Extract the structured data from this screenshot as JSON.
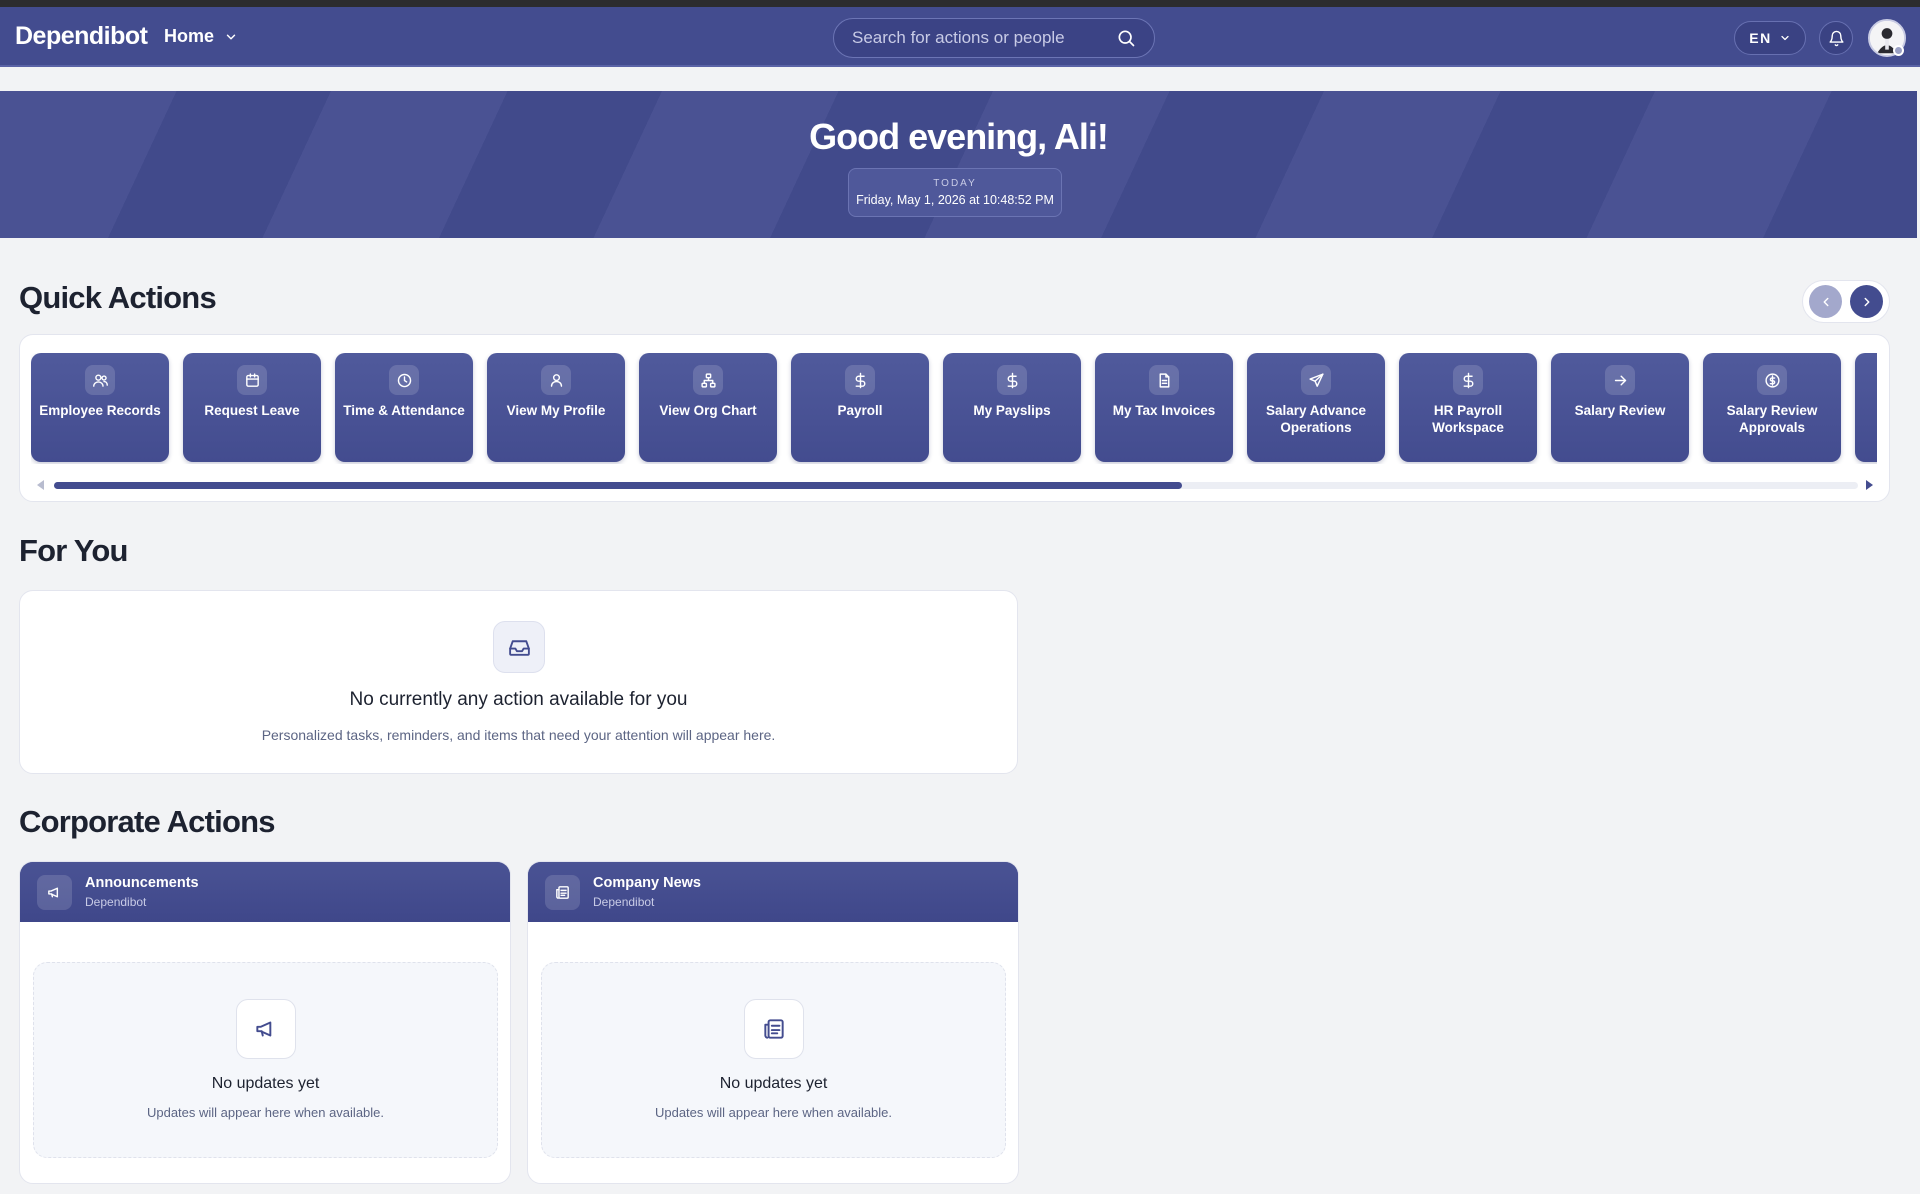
{
  "header": {
    "brand": "Dependibot",
    "home_label": "Home",
    "search_placeholder": "Search for actions or people",
    "language": "EN"
  },
  "hero": {
    "greeting": "Good evening, Ali!",
    "today_label": "TODAY",
    "today_value": "Friday, May 1, 2026 at 10:48:52 PM"
  },
  "quick_actions": {
    "title": "Quick Actions",
    "scroll_position_fraction": 0.62,
    "items": [
      {
        "label": "Employee Records",
        "icon": "users-icon"
      },
      {
        "label": "Request Leave",
        "icon": "calendar-icon"
      },
      {
        "label": "Time & Attendance",
        "icon": "clock-icon"
      },
      {
        "label": "View My Profile",
        "icon": "user-icon"
      },
      {
        "label": "View Org Chart",
        "icon": "org-chart-icon"
      },
      {
        "label": "Payroll",
        "icon": "dollar-icon"
      },
      {
        "label": "My Payslips",
        "icon": "dollar-icon"
      },
      {
        "label": "My Tax Invoices",
        "icon": "document-icon"
      },
      {
        "label": "Salary Advance Operations",
        "icon": "send-icon"
      },
      {
        "label": "HR Payroll Workspace",
        "icon": "dollar-icon"
      },
      {
        "label": "Salary Review",
        "icon": "arrow-right-icon"
      },
      {
        "label": "Salary Review Approvals",
        "icon": "dollar-circle-icon"
      }
    ]
  },
  "for_you": {
    "title": "For You",
    "empty_title": "No currently any action available for you",
    "empty_subtitle": "Personalized tasks, reminders, and items that need your attention will appear here."
  },
  "corporate": {
    "title": "Corporate Actions",
    "cards": [
      {
        "title": "Announcements",
        "subtitle": "Dependibot",
        "icon": "megaphone-icon",
        "empty_title": "No updates yet",
        "empty_subtitle": "Updates will appear here when available."
      },
      {
        "title": "Company News",
        "subtitle": "Dependibot",
        "icon": "newspaper-icon",
        "empty_title": "No updates yet",
        "empty_subtitle": "Updates will appear here when available."
      }
    ]
  },
  "colors": {
    "brand_primary": "#434c8f",
    "page_background": "#f2f3f5"
  }
}
